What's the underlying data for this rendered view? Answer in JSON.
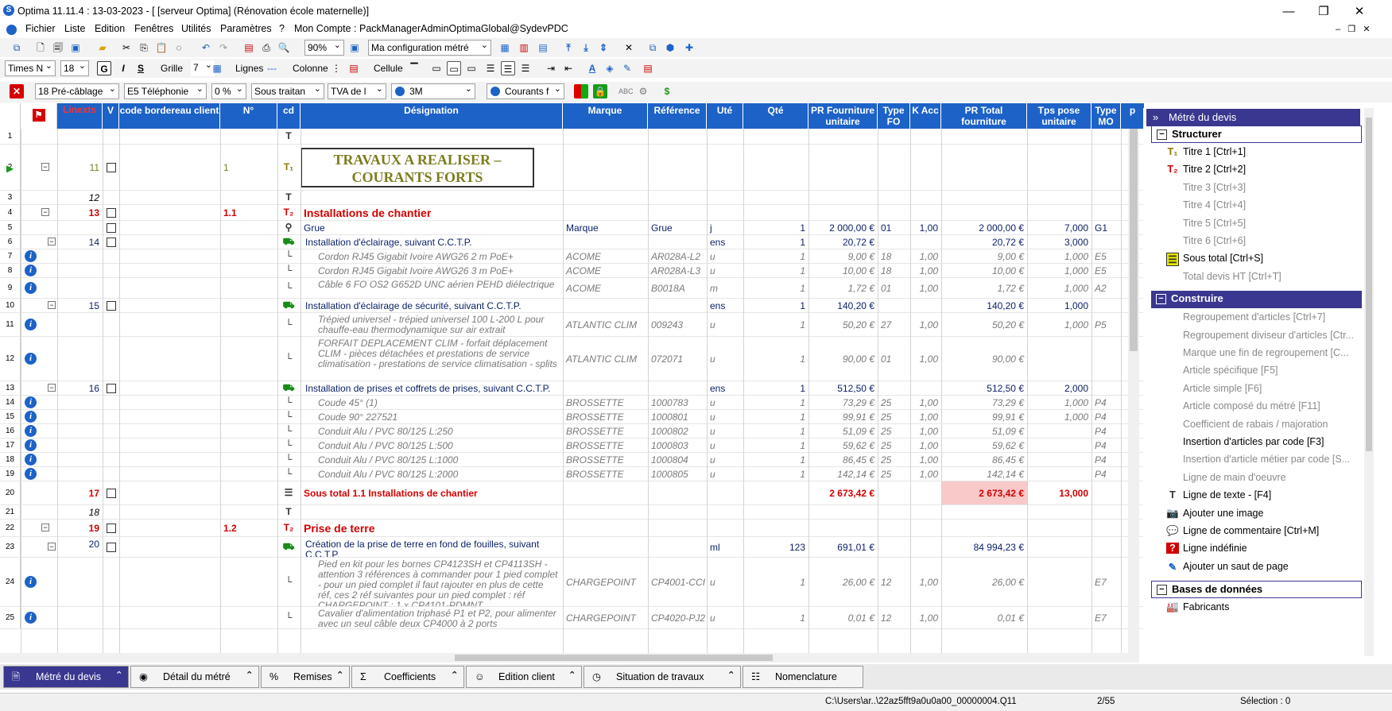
{
  "window": {
    "title": "Optima 11.11.4 : 13-03-2023 - [ [serveur Optima] (Rénovation école maternelle)]",
    "controls": [
      "—",
      "❐",
      "✕"
    ]
  },
  "menu": {
    "items": [
      "Fichier",
      "Liste",
      "Edition",
      "Fenêtres",
      "Utilités",
      "Paramètres",
      "?",
      "Mon Compte : PackManagerAdminOptimaGlobal@SydevPDC"
    ]
  },
  "toolbar1": {
    "zoom": "90%",
    "config": "Ma configuration métré"
  },
  "toolbar2": {
    "font": "Times N",
    "size": "18",
    "grille_label": "Grille",
    "grille_value": "7",
    "lignes_label": "Lignes",
    "colonnes_label": "Colonne",
    "cellule_label": "Cellule"
  },
  "toolbar3": {
    "lot": "18  Pré-câblage",
    "e5": "E5   Téléphonie",
    "pct": "0 %",
    "sous": "Sous traitan",
    "tva": "TVA de l",
    "code": "3M",
    "courants": "Courants f"
  },
  "columns": {
    "linexts": "Linexts",
    "v": "V",
    "code_bordereau": "code bordereau client",
    "no": "N°",
    "cd": "cd",
    "designation": "Désignation",
    "marque": "Marque",
    "reference": "Référence",
    "ute": "Uté",
    "qte": "Qté",
    "pr_fourn": "PR Fourniture unitaire",
    "type_fo": "Type FO",
    "k_acc": "K Acc",
    "pr_total": "PR Total fourniture",
    "tps_pose": "Tps pose unitaire",
    "type_mo": "Type MO",
    "extra": "p"
  },
  "rows": [
    {
      "n": "1",
      "lx": "",
      "no": "",
      "des": "",
      "marque": "",
      "ref": "",
      "ute": "",
      "qte": "",
      "pr": "",
      "tfo": "",
      "k": "",
      "tot": "",
      "tps": "",
      "tmo": ""
    },
    {
      "n": "2",
      "lx": "11",
      "no": "1",
      "des": "TRAVAUX A REALISER – COURANTS FORTS",
      "marque": "",
      "ref": "",
      "ute": "",
      "qte": "",
      "pr": "",
      "tfo": "",
      "k": "",
      "tot": "",
      "tps": "",
      "tmo": ""
    },
    {
      "n": "3",
      "lx": "12",
      "no": "",
      "des": "",
      "marque": "",
      "ref": "",
      "ute": "",
      "qte": "",
      "pr": "",
      "tfo": "",
      "k": "",
      "tot": "",
      "tps": "",
      "tmo": ""
    },
    {
      "n": "4",
      "lx": "13",
      "no": "1.1",
      "des": "Installations de chantier",
      "marque": "",
      "ref": "",
      "ute": "",
      "qte": "",
      "pr": "",
      "tfo": "",
      "k": "",
      "tot": "",
      "tps": "",
      "tmo": ""
    },
    {
      "n": "5",
      "lx": "",
      "no": "",
      "des": "Grue",
      "marque": "Marque",
      "ref": "Grue",
      "ute": "j",
      "qte": "1",
      "pr": "2 000,00 €",
      "tfo": "01",
      "k": "1,00",
      "tot": "2 000,00 €",
      "tps": "7,000",
      "tmo": "G1"
    },
    {
      "n": "6",
      "lx": "14",
      "no": "",
      "des": "Installation d'éclairage, suivant C.C.T.P.",
      "marque": "",
      "ref": "",
      "ute": "ens",
      "qte": "1",
      "pr": "20,72 €",
      "tfo": "",
      "k": "",
      "tot": "20,72 €",
      "tps": "3,000",
      "tmo": ""
    },
    {
      "n": "7",
      "lx": "",
      "no": "",
      "des": "Cordon RJ45 Gigabit Ivoire AWG26 2 m PoE+",
      "marque": "ACOME",
      "ref": "AR028A-L2",
      "ute": "u",
      "qte": "1",
      "pr": "9,00 €",
      "tfo": "18",
      "k": "1,00",
      "tot": "9,00 €",
      "tps": "1,000",
      "tmo": "E5"
    },
    {
      "n": "8",
      "lx": "",
      "no": "",
      "des": "Cordon RJ45 Gigabit Ivoire AWG26 3 m PoE+",
      "marque": "ACOME",
      "ref": "AR028A-L3",
      "ute": "u",
      "qte": "1",
      "pr": "10,00 €",
      "tfo": "18",
      "k": "1,00",
      "tot": "10,00 €",
      "tps": "1,000",
      "tmo": "E5"
    },
    {
      "n": "9",
      "lx": "",
      "no": "",
      "des": "Câble 6 FO OS2 G652D UNC aérien PEHD diélectrique",
      "marque": "ACOME",
      "ref": "B0018A",
      "ute": "m",
      "qte": "1",
      "pr": "1,72 €",
      "tfo": "01",
      "k": "1,00",
      "tot": "1,72 €",
      "tps": "1,000",
      "tmo": "A2"
    },
    {
      "n": "10",
      "lx": "15",
      "no": "",
      "des": "Installation d'éclairage de sécurité, suivant C.C.T.P.",
      "marque": "",
      "ref": "",
      "ute": "ens",
      "qte": "1",
      "pr": "140,20 €",
      "tfo": "",
      "k": "",
      "tot": "140,20 €",
      "tps": "1,000",
      "tmo": ""
    },
    {
      "n": "11",
      "lx": "",
      "no": "",
      "des": "Trépied universel - trépied universel 100 L-200 L pour chauffe-eau thermodynamique sur air extrait",
      "marque": "ATLANTIC CLIM",
      "ref": "009243",
      "ute": "u",
      "qte": "1",
      "pr": "50,20 €",
      "tfo": "27",
      "k": "1,00",
      "tot": "50,20 €",
      "tps": "1,000",
      "tmo": "P5"
    },
    {
      "n": "12",
      "lx": "",
      "no": "",
      "des": "FORFAIT DEPLACEMENT CLIM - forfait déplacement CLIM - pièces détachées et prestations de service climatisation - prestations de service climatisation - splits",
      "marque": "ATLANTIC CLIM",
      "ref": "072071",
      "ute": "u",
      "qte": "1",
      "pr": "90,00 €",
      "tfo": "01",
      "k": "1,00",
      "tot": "90,00 €",
      "tps": "",
      "tmo": ""
    },
    {
      "n": "13",
      "lx": "16",
      "no": "",
      "des": "Installation de prises et coffrets de prises, suivant C.C.T.P.",
      "marque": "",
      "ref": "",
      "ute": "ens",
      "qte": "1",
      "pr": "512,50 €",
      "tfo": "",
      "k": "",
      "tot": "512,50 €",
      "tps": "2,000",
      "tmo": ""
    },
    {
      "n": "14",
      "lx": "",
      "no": "",
      "des": "Coude 45° (1)",
      "marque": "BROSSETTE",
      "ref": "1000783",
      "ute": "u",
      "qte": "1",
      "pr": "73,29 €",
      "tfo": "25",
      "k": "1,00",
      "tot": "73,29 €",
      "tps": "1,000",
      "tmo": "P4"
    },
    {
      "n": "15",
      "lx": "",
      "no": "",
      "des": "Coude 90° 227521",
      "marque": "BROSSETTE",
      "ref": "1000801",
      "ute": "u",
      "qte": "1",
      "pr": "99,91 €",
      "tfo": "25",
      "k": "1,00",
      "tot": "99,91 €",
      "tps": "1,000",
      "tmo": "P4"
    },
    {
      "n": "16",
      "lx": "",
      "no": "",
      "des": "Conduit Alu / PVC 80/125 L:250",
      "marque": "BROSSETTE",
      "ref": "1000802",
      "ute": "u",
      "qte": "1",
      "pr": "51,09 €",
      "tfo": "25",
      "k": "1,00",
      "tot": "51,09 €",
      "tps": "",
      "tmo": "P4"
    },
    {
      "n": "17",
      "lx": "",
      "no": "",
      "des": "Conduit Alu / PVC 80/125 L:500",
      "marque": "BROSSETTE",
      "ref": "1000803",
      "ute": "u",
      "qte": "1",
      "pr": "59,62 €",
      "tfo": "25",
      "k": "1,00",
      "tot": "59,62 €",
      "tps": "",
      "tmo": "P4"
    },
    {
      "n": "18",
      "lx": "",
      "no": "",
      "des": "Conduit Alu / PVC 80/125 L:1000",
      "marque": "BROSSETTE",
      "ref": "1000804",
      "ute": "u",
      "qte": "1",
      "pr": "86,45 €",
      "tfo": "25",
      "k": "1,00",
      "tot": "86,45 €",
      "tps": "",
      "tmo": "P4"
    },
    {
      "n": "19",
      "lx": "",
      "no": "",
      "des": "Conduit Alu / PVC 80/125 L:2000",
      "marque": "BROSSETTE",
      "ref": "1000805",
      "ute": "u",
      "qte": "1",
      "pr": "142,14 €",
      "tfo": "25",
      "k": "1,00",
      "tot": "142,14 €",
      "tps": "",
      "tmo": "P4"
    },
    {
      "n": "20",
      "lx": "17",
      "no": "",
      "des": "Sous total 1.1 Installations de chantier",
      "marque": "",
      "ref": "",
      "ute": "",
      "qte": "",
      "pr": "2 673,42 €",
      "tfo": "",
      "k": "",
      "tot": "2 673,42 €",
      "tps": "13,000",
      "tmo": ""
    },
    {
      "n": "21",
      "lx": "18",
      "no": "",
      "des": "",
      "marque": "",
      "ref": "",
      "ute": "",
      "qte": "",
      "pr": "",
      "tfo": "",
      "k": "",
      "tot": "",
      "tps": "",
      "tmo": ""
    },
    {
      "n": "22",
      "lx": "19",
      "no": "1.2",
      "des": "Prise de terre",
      "marque": "",
      "ref": "",
      "ute": "",
      "qte": "",
      "pr": "",
      "tfo": "",
      "k": "",
      "tot": "",
      "tps": "",
      "tmo": ""
    },
    {
      "n": "23",
      "lx": "20",
      "no": "",
      "des": "Création de la prise de terre en fond de fouilles, suivant C.C.T.P.",
      "marque": "",
      "ref": "",
      "ute": "ml",
      "qte": "123",
      "pr": "691,01 €",
      "tfo": "",
      "k": "",
      "tot": "84 994,23 €",
      "tps": "",
      "tmo": ""
    },
    {
      "n": "24",
      "lx": "",
      "no": "",
      "des": "Pied en kit pour les bornes CP4123SH et CP4113SH - attention 3 références à commander pour 1 pied complet - pour un pied complet il faut rajouter en plus de cette réf, ces 2 réf suivantes pour un pied complet : réf CHARGEPOINT : 1 x CP4101-PDMNT",
      "marque": "CHARGEPOINT",
      "ref": "CP4001-CCI",
      "ute": "u",
      "qte": "1",
      "pr": "26,00 €",
      "tfo": "12",
      "k": "1,00",
      "tot": "26,00 €",
      "tps": "",
      "tmo": "E7"
    },
    {
      "n": "25",
      "lx": "",
      "no": "",
      "des": "Cavalier d'alimentation triphasé P1 et P2, pour alimenter avec un seul câble deux CP4000 à 2 ports",
      "marque": "CHARGEPOINT",
      "ref": "CP4020-PJ2",
      "ute": "u",
      "qte": "1",
      "pr": "0,01 €",
      "tfo": "12",
      "k": "1,00",
      "tot": "0,01 €",
      "tps": "",
      "tmo": "E7"
    }
  ],
  "panel": {
    "title": "Métré du devis",
    "sections": [
      {
        "name": "Structurer",
        "items": [
          "Titre 1 [Ctrl+1]",
          "Titre 2 [Ctrl+2]",
          "Titre 3 [Ctrl+3]",
          "Titre 4 [Ctrl+4]",
          "Titre 5 [Ctrl+5]",
          "Titre 6 [Ctrl+6]",
          "Sous total [Ctrl+S]",
          "Total devis HT [Ctrl+T]"
        ]
      },
      {
        "name": "Construire",
        "items": [
          "Regroupement d'articles  [Ctrl+7]",
          "Regroupement diviseur d'articles  [Ctr...",
          "Marque une fin de regroupement  [C...",
          "Article spécifique [F5]",
          "Article simple [F6]",
          "Article composé du métré [F11]",
          "Coefficient de rabais / majoration",
          "Insertion d'articles par code [F3]",
          "Insertion d'article métier par code [S...",
          "Ligne de main d'oeuvre",
          "Ligne de texte - [F4]",
          "Ajouter une image",
          "Ligne de commentaire [Ctrl+M]",
          "Ligne indéfinie",
          "Ajouter un saut de page"
        ]
      },
      {
        "name": "Bases de données",
        "items": [
          "Fabricants"
        ]
      }
    ]
  },
  "tabs": [
    "Métré du devis",
    "Détail du métré",
    "Remises",
    "Coefficients",
    "Edition client",
    "Situation de travaux",
    "Nomenclature"
  ],
  "status": {
    "path": "C:\\Users\\ar..\\22az5fft9a0u0a00_00000004.Q11",
    "page": "2/55",
    "selection": "Sélection : 0"
  },
  "colors": {
    "header_blue": "#1d62c7",
    "red": "#d40000",
    "navy": "#0a1f66",
    "olive": "#7c7c1e",
    "panel_purple": "#3a3790"
  }
}
